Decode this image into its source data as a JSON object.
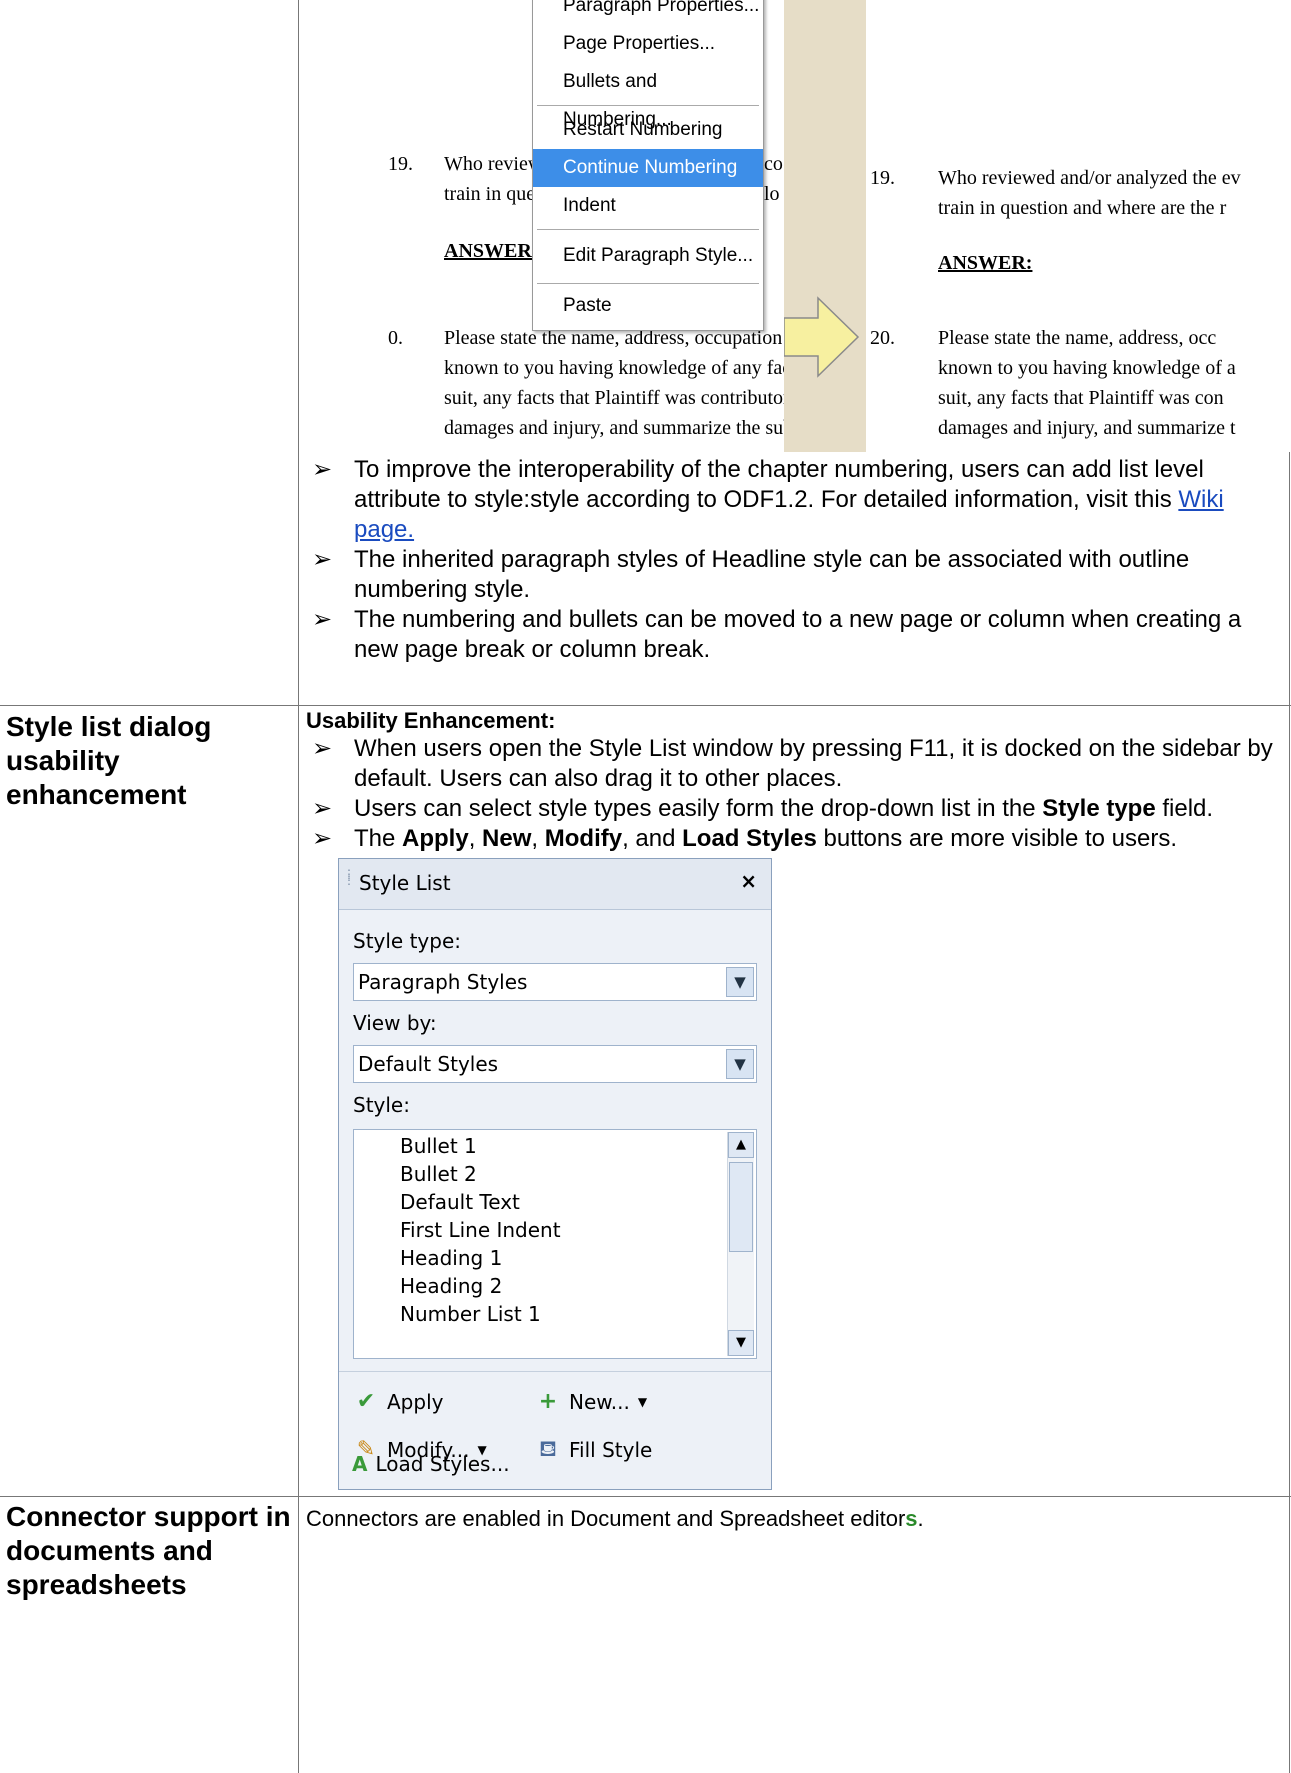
{
  "row1": {
    "screenshot": {
      "context_menu": {
        "items": [
          "Paragraph Properties...",
          "Page Properties...",
          "Bullets and Numbering...",
          "Restart Numbering",
          "Continue Numbering",
          "Indent",
          "Edit Paragraph Style...",
          "Paste"
        ],
        "selected": "Continue Numbering"
      },
      "left_doc": {
        "num_19": "19.",
        "line_19a": "Who review",
        "line_19a_tail": "co",
        "line_19b": "train in que",
        "line_19b_tail": "lo",
        "answer": "ANSWER:",
        "num_20": "0.",
        "line_20a": "Please state the name, address, occupation",
        "line_20b": "known to you having knowledge of any facts",
        "line_20c": "suit, any facts that Plaintiff was contributori",
        "line_20d": "damages and injury, and summarize the subje"
      },
      "right_doc": {
        "num_19": "19.",
        "line_19a": "Who reviewed and/or analyzed the ev",
        "line_19b": "train in question and where are the r",
        "answer": "ANSWER:",
        "num_20": "20.",
        "line_20a": "Please state the name, address, occ",
        "line_20b": "known to you having knowledge of a",
        "line_20c": "suit, any facts that Plaintiff was con",
        "line_20d": "damages and injury, and summarize t"
      }
    },
    "bullets": [
      {
        "before": "To improve the interoperability of the chapter numbering, users can add list level attribute to style:style according to ODF1.2. For detailed information, visit this ",
        "link": "Wiki page.",
        "after": ""
      },
      {
        "before": "The inherited paragraph styles of Headline style can be associated with outline numbering style.",
        "link": "",
        "after": ""
      },
      {
        "before": "The numbering and bullets can be moved to a  new page or column when creating a new page break or column break.",
        "link": "",
        "after": ""
      }
    ]
  },
  "row2": {
    "feature": "Style list dialog usability enhancement",
    "subheading": "Usability Enhancement:",
    "bullet1": "When users open the Style List window by pressing F11, it is docked on the sidebar by default. Users can also drag it to other places.",
    "bullet2_a": "Users can select style types easily form the drop-down list in the ",
    "bullet2_b": "Style type",
    "bullet2_c": " field.",
    "bullet3_a": "The ",
    "bullet3_apply": "Apply",
    "bullet3_sep1": ", ",
    "bullet3_new": "New",
    "bullet3_sep2": ", ",
    "bullet3_modify": "Modify",
    "bullet3_sep3": ", and ",
    "bullet3_load": "Load Styles",
    "bullet3_end": " buttons are more visible to users.",
    "panel": {
      "title": "Style List",
      "style_type_label": "Style type:",
      "style_type_value": "Paragraph Styles",
      "view_by_label": "View by:",
      "view_by_value": "Default Styles",
      "style_label": "Style:",
      "styles": [
        "Bullet 1",
        "Bullet 2",
        "Default Text",
        "First Line Indent",
        "Heading 1",
        "Heading 2",
        "Number List 1"
      ],
      "apply": "Apply",
      "new": "New...",
      "modify": "Modify...",
      "fill_style": "Fill Style",
      "load_styles": "Load Styles..."
    }
  },
  "row3": {
    "feature": "Connector support in documents and spreadsheets",
    "text_main": "Connectors are enabled in Document and Spreadsheet editor",
    "text_tail": "s",
    "text_end": "."
  },
  "colors": {
    "link": "#1a4bbf",
    "menu_selected": "#3d8ee8",
    "accent_green": "#2a8a2a"
  }
}
